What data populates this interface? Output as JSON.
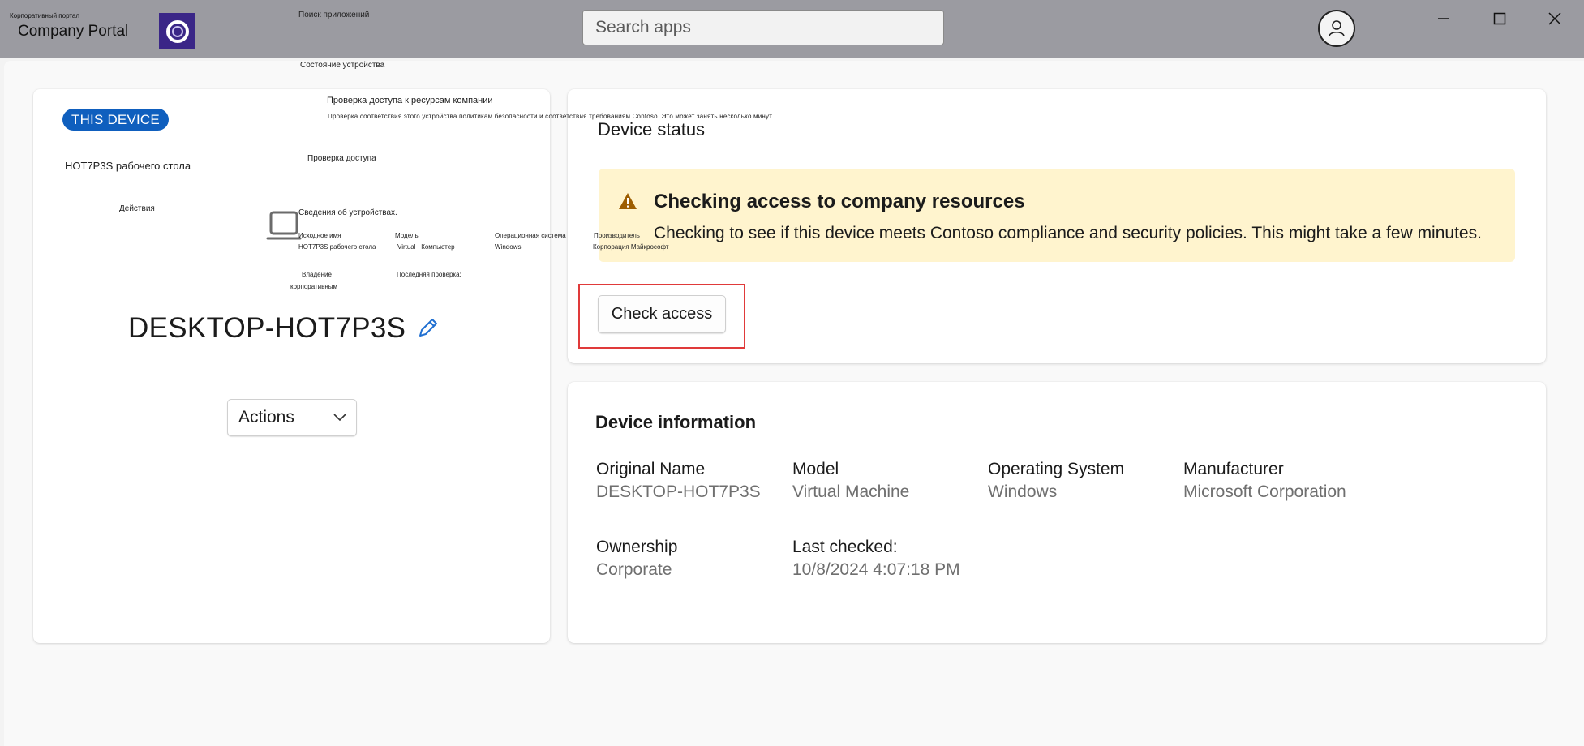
{
  "titlebar": {
    "app_label_small": "Корпоративный портал",
    "app_title": "Company Portal",
    "search_placeholder": "Search apps"
  },
  "overlay": {
    "search_apps": "Поиск приложений",
    "device_state": "Состояние устройства",
    "check_access_title": "Проверка доступа к ресурсам компании",
    "check_access_desc": "Проверка соответствия этого устройства политикам безопасности и соответствия требованиям Contoso. Это может занять несколько минут.",
    "check_access": "Проверка доступа",
    "device_name_local": "HOT7P3S рабочего стола",
    "actions": "Действия",
    "device_info": "Сведения об устройствах.",
    "original_name": "Исходное имя",
    "original_name_value": "HOT7P3S рабочего стола",
    "model": "Модель",
    "model_value": "Virtual   Компьютер",
    "os": "Операционная система",
    "os_value": "Windows",
    "manufacturer": "Производитель",
    "manufacturer_value": "Корпорация Майкрософт",
    "ownership": "Владение",
    "ownership_value": "корпоративным",
    "last_checked": "Последняя проверка:"
  },
  "device_card": {
    "badge": "THIS DEVICE",
    "device_name": "DESKTOP-HOT7P3S",
    "edit_icon": "pencil-icon",
    "actions_label": "Actions"
  },
  "status": {
    "title": "Device status",
    "warning_title": "Checking access to company resources",
    "warning_text": "Checking to see if this device meets Contoso compliance and security policies. This might take a few minutes.",
    "check_button": "Check access"
  },
  "info": {
    "title": "Device information",
    "original_name_label": "Original Name",
    "original_name_value": "DESKTOP-HOT7P3S",
    "model_label": "Model",
    "model_value": "Virtual Machine",
    "os_label": "Operating System",
    "os_value": "Windows",
    "manufacturer_label": "Manufacturer",
    "manufacturer_value": "Microsoft Corporation",
    "ownership_label": "Ownership",
    "ownership_value": "Corporate",
    "last_checked_label": "Last checked:",
    "last_checked_value": "10/8/2024 4:07:18 PM"
  },
  "colors": {
    "accent": "#0f5fbe",
    "warning_bg": "#fff4ce",
    "warning_icon": "#9d5d00",
    "highlight": "#e03a3a",
    "titlebar": "#9b9ba1"
  }
}
